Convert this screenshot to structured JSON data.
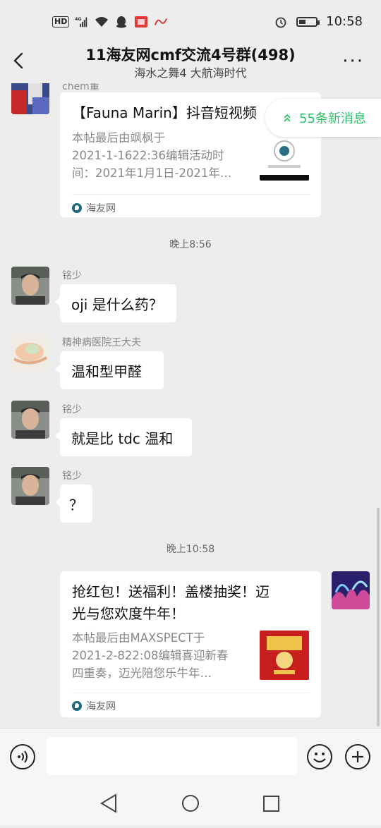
{
  "status_bar": {
    "hd": "HD",
    "network": "4G",
    "time": "10:58",
    "icons": [
      "hd-icon",
      "signal-icon",
      "wifi-icon",
      "qq-icon",
      "app-icon",
      "alarm-icon",
      "battery-icon"
    ],
    "battery_level": 0.3
  },
  "header": {
    "title": "11海友网cmf交流4号群(498)",
    "subtitle": "海水之舞4 大航海时代",
    "more": "···"
  },
  "new_messages": {
    "label": "55条新消息",
    "color": "#2ebd6b"
  },
  "messages": [
    {
      "type": "card",
      "sender": "chem董",
      "title": "【Fauna Marin】抖音短视频",
      "desc_lines": [
        "本帖最后由飒枫于",
        "2021-1-1622:36编辑活动时",
        "间：2021年1月1日-2021年…"
      ],
      "source": "海友网"
    },
    {
      "type": "time",
      "text": "晚上8:56"
    },
    {
      "type": "text",
      "sender": "铭少",
      "text": "oji 是什么药？"
    },
    {
      "type": "text",
      "sender": "精神病医院王大夫",
      "text": "温和型甲醛"
    },
    {
      "type": "text",
      "sender": "铭少",
      "text": "就是比 tdc 温和"
    },
    {
      "type": "text",
      "sender": "铭少",
      "text": "？"
    },
    {
      "type": "time",
      "text": "晚上10:58"
    },
    {
      "type": "card",
      "from_self": true,
      "title_lines": [
        "抢红包！送福利！盖楼抽奖！迈",
        "光与您欢度牛年！"
      ],
      "desc_lines": [
        "本帖最后由MAXSPECT于",
        "2021-2-822:08编辑喜迎新春",
        "四重奏，迈光陪您乐牛年…"
      ],
      "source": "海友网"
    }
  ],
  "colors": {
    "background": "#ededed",
    "bubble": "#ffffff",
    "accent": "#2ebd6b"
  }
}
